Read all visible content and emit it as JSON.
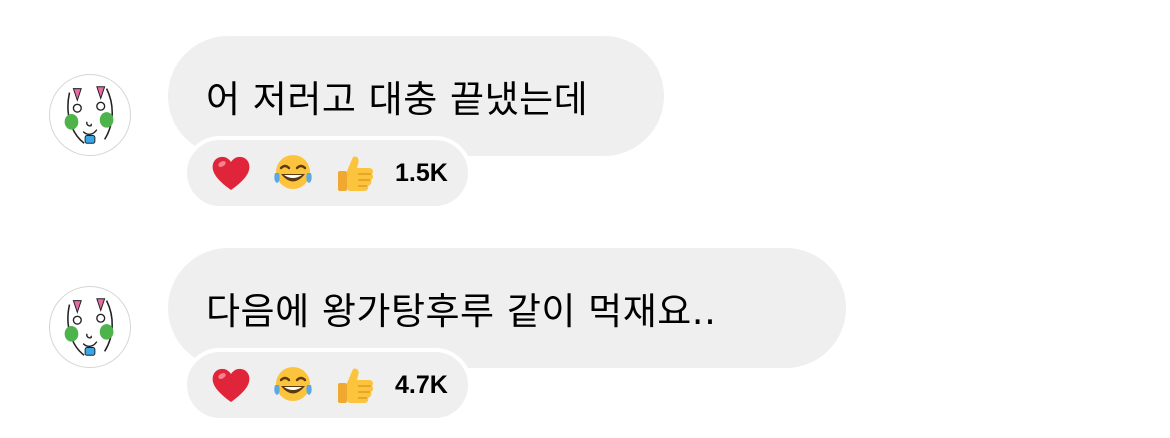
{
  "messages": [
    {
      "text": "어 저러고 대충 끝냈는데",
      "reactions": [
        "heart",
        "laughing-tears",
        "thumbs-up"
      ],
      "reaction_count": "1.5K"
    },
    {
      "text": "다음에 왕가탕후루 같이 먹재요..",
      "reactions": [
        "heart",
        "laughing-tears",
        "thumbs-up"
      ],
      "reaction_count": "4.7K"
    }
  ],
  "colors": {
    "bubble": "#efefef",
    "heart": "#e0243a",
    "emoji_yellow": "#fcc43d"
  }
}
